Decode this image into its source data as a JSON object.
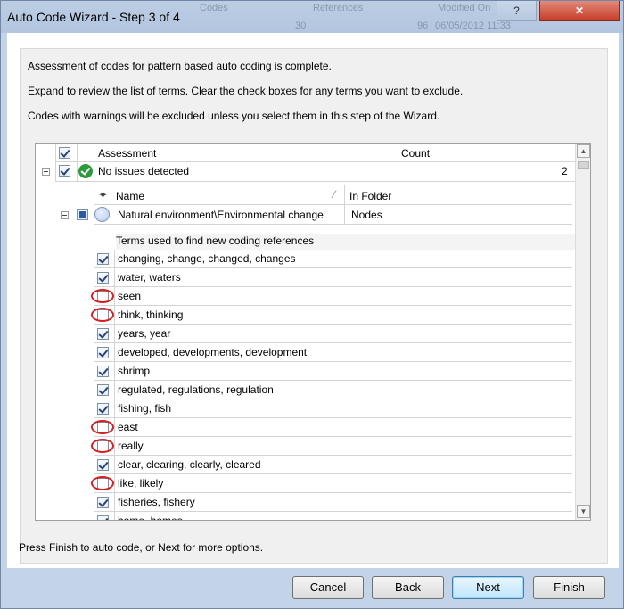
{
  "window": {
    "title": "Auto Code Wizard - Step 3 of 4",
    "help_label": "?",
    "close_label": "✕",
    "background_bleed": [
      "Codes",
      "References",
      "Modified On",
      "30",
      "96",
      "06/05/2012 11:33"
    ]
  },
  "intro": {
    "line1": "Assessment of codes for pattern based auto coding is complete.",
    "line2": "Expand to review the list of terms. Clear the check boxes for any terms you want to exclude.",
    "line3": "Codes with warnings will be excluded unless you select them in this step of the Wizard."
  },
  "grid": {
    "header": {
      "assessment": "Assessment",
      "count": "Count"
    },
    "assessment_row": {
      "label": "No issues detected",
      "count": "2",
      "checked": true
    },
    "node_header": {
      "name": "Name",
      "in_folder": "In Folder"
    },
    "node_row": {
      "name": "Natural environment\\Environmental change",
      "folder": "Nodes"
    },
    "terms_header": "Terms used to find new coding references",
    "terms": [
      {
        "text": "changing, change, changed, changes",
        "checked": true
      },
      {
        "text": "water, waters",
        "checked": true
      },
      {
        "text": "seen",
        "checked": false
      },
      {
        "text": "think, thinking",
        "checked": false
      },
      {
        "text": "years, year",
        "checked": true
      },
      {
        "text": "developed, developments, development",
        "checked": true
      },
      {
        "text": "shrimp",
        "checked": true
      },
      {
        "text": "regulated, regulations, regulation",
        "checked": true
      },
      {
        "text": "fishing, fish",
        "checked": true
      },
      {
        "text": "east",
        "checked": false
      },
      {
        "text": "really",
        "checked": false
      },
      {
        "text": "clear, clearing, clearly, cleared",
        "checked": true
      },
      {
        "text": "like, likely",
        "checked": false
      },
      {
        "text": "fisheries, fishery",
        "checked": true
      },
      {
        "text": "home, homes",
        "checked": true
      }
    ]
  },
  "footer": {
    "hint": "Press Finish to auto code, or Next for more options.",
    "cancel_label": "Cancel",
    "back_label": "Back",
    "next_label": "Next",
    "finish_label": "Finish"
  },
  "colors": {
    "highlight_ring": "#d32020",
    "ok_green": "#2e9a3e",
    "title_bar": "#b8cae1"
  },
  "icons": {
    "ok": "green-check-circle-icon",
    "node": "node-circle-icon",
    "pin": "pin-icon"
  }
}
